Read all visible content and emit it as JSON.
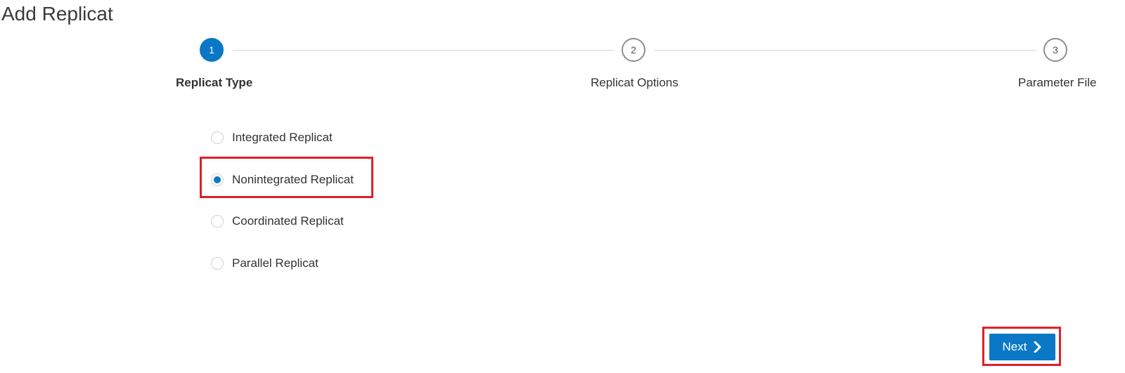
{
  "page": {
    "title": "Add Replicat"
  },
  "stepper": {
    "steps": [
      {
        "number": "1",
        "label": "Replicat Type",
        "state": "active"
      },
      {
        "number": "2",
        "label": "Replicat Options",
        "state": "inactive"
      },
      {
        "number": "3",
        "label": "Parameter File",
        "state": "inactive"
      }
    ]
  },
  "replicat_type": {
    "selected": "Nonintegrated Replicat",
    "options": [
      {
        "label": "Integrated Replicat",
        "checked": false
      },
      {
        "label": "Nonintegrated Replicat",
        "checked": true
      },
      {
        "label": "Coordinated Replicat",
        "checked": false
      },
      {
        "label": "Parallel Replicat",
        "checked": false
      }
    ]
  },
  "footer": {
    "next_label": "Next",
    "next_icon": "chevron-right-icon"
  },
  "colors": {
    "accent": "#0a78c6",
    "highlight": "#e0202a"
  }
}
